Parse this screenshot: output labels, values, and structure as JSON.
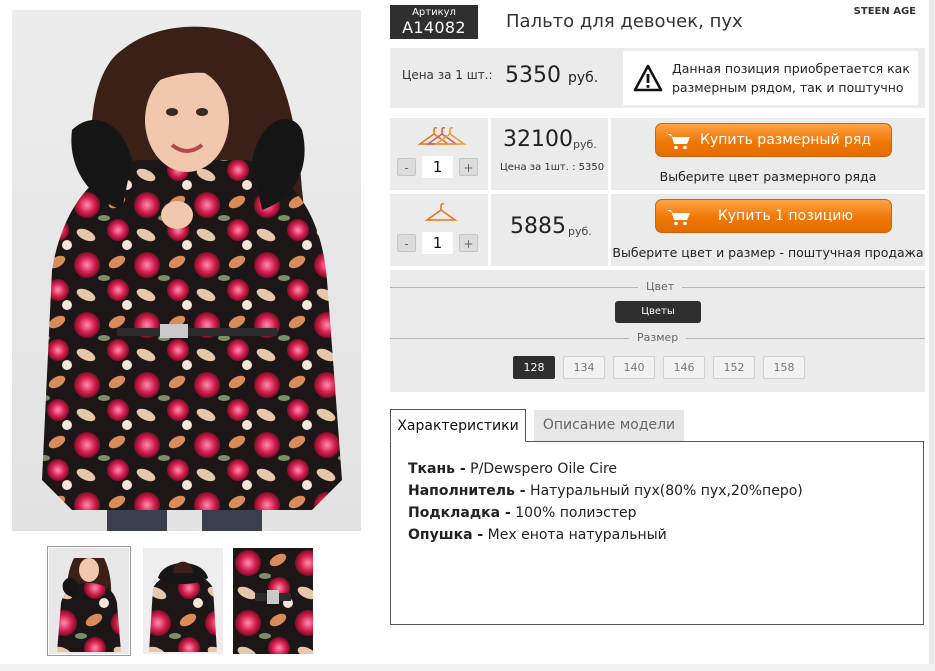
{
  "product": {
    "sku_label": "Артикул",
    "sku": "A14082",
    "title": "Пальто для девочек, пух",
    "brand": "STEEN AGE"
  },
  "unit_price": {
    "label": "Цена за 1 шт.:",
    "value": "5350",
    "currency": "руб."
  },
  "notice": {
    "icon": "warning-icon",
    "text": "Данная позиция приобретается как размерным рядом, так и поштучно"
  },
  "buy_set": {
    "icon": "hangers-icon",
    "qty": "1",
    "minus": "-",
    "plus": "+",
    "price": "32100",
    "currency": "руб.",
    "unit_note": "Цена за 1шт. : 5350",
    "button": "Купить размерный ряд",
    "hint": "Выберите цвет размерного ряда"
  },
  "buy_single": {
    "icon": "hanger-icon",
    "qty": "1",
    "minus": "-",
    "plus": "+",
    "price": "5885",
    "currency": "руб.",
    "button": "Купить 1 позицию",
    "hint": "Выберите цвет и размер - поштучная продажа"
  },
  "options": {
    "color_title": "Цвет",
    "color_selected": "Цветы",
    "size_title": "Размер",
    "sizes": [
      "128",
      "134",
      "140",
      "146",
      "152",
      "158"
    ],
    "size_selected": "128"
  },
  "tabs": {
    "active": "Характеристики",
    "inactive": "Описание модели"
  },
  "specs": [
    {
      "key": "Ткань -",
      "value": "P/Dewspero Oile Cire"
    },
    {
      "key": "Наполнитель -",
      "value": "Натуральный пух(80% пух,20%перо)"
    },
    {
      "key": "Подкладка -",
      "value": "100% полиэстер"
    },
    {
      "key": "Опушка -",
      "value": "Мех енота натуральный"
    }
  ],
  "colors": {
    "accent_orange": "#f07806",
    "dark": "#2e2e2e",
    "panel_gray": "#ebebeb"
  }
}
